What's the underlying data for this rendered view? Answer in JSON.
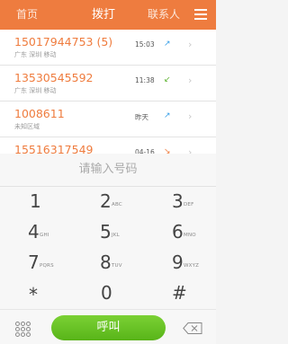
{
  "tabs": {
    "home": "首页",
    "dial": "拨打",
    "contacts": "联系人"
  },
  "calls": [
    {
      "number": "15017944753 (5)",
      "location": "广东 深圳  移动",
      "time": "15:03",
      "arrow": "↗",
      "arrow_color": "#3aa0e8"
    },
    {
      "number": "13530545592",
      "location": "广东 深圳  移动",
      "time": "11:38",
      "arrow": "↙",
      "arrow_color": "#59b12b"
    },
    {
      "number": "1008611",
      "location": "未知区域",
      "time": "昨天",
      "arrow": "↗",
      "arrow_color": "#3aa0e8"
    },
    {
      "number": "15516317549",
      "location": "",
      "time": "04-16",
      "arrow": "↘",
      "arrow_color": "#ef7c3e"
    }
  ],
  "input": {
    "placeholder": "请输入号码"
  },
  "keys": [
    {
      "digit": "1",
      "letters": ""
    },
    {
      "digit": "2",
      "letters": "ABC"
    },
    {
      "digit": "3",
      "letters": "DEF"
    },
    {
      "digit": "4",
      "letters": "GHI"
    },
    {
      "digit": "5",
      "letters": "JKL"
    },
    {
      "digit": "6",
      "letters": "MNO"
    },
    {
      "digit": "7",
      "letters": "PQRS"
    },
    {
      "digit": "8",
      "letters": "TUV"
    },
    {
      "digit": "9",
      "letters": "WXYZ"
    },
    {
      "digit": "*",
      "letters": ""
    },
    {
      "digit": "0",
      "letters": ""
    },
    {
      "digit": "#",
      "letters": ""
    }
  ],
  "call_button": {
    "label": "呼叫"
  },
  "icons": {
    "menu": "menu-icon",
    "keypad": "keypad-grid-icon",
    "delete": "backspace-icon"
  },
  "colors": {
    "brand": "#ee7c3f",
    "call_green": "#6cc425"
  }
}
